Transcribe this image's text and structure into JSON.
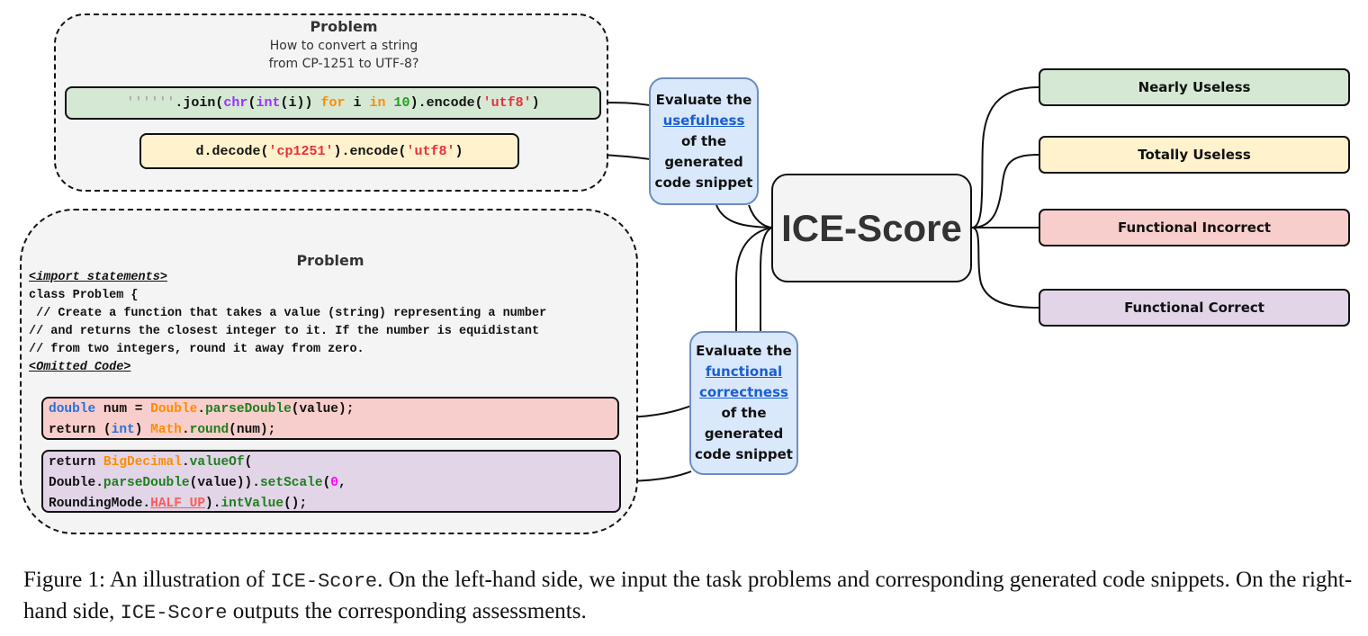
{
  "colors": {
    "green_box": "#d5e8d4",
    "yellow_box": "#fff2cc",
    "red_box": "#f8cecc",
    "purple_box": "#e1d5e7",
    "bubble": "#dae8fc",
    "bubble_border": "#6c8ebf",
    "center_box": "#f4f4f4"
  },
  "top_group": {
    "title": "Problem",
    "description_line1": "How to convert a string",
    "description_line2": "from CP-1251 to UTF-8?",
    "snippet_1": {
      "tokens": [
        "''''''",
        ".join(",
        "chr",
        "(",
        "int",
        "(i)) ",
        "for",
        " i ",
        "in",
        " ",
        "10",
        ").encode(",
        "'utf8'",
        ")"
      ]
    },
    "snippet_2": {
      "tokens": [
        "d.decode(",
        "'cp1251'",
        ").encode(",
        "'utf8'",
        ")"
      ]
    }
  },
  "bottom_group": {
    "title": "Problem",
    "import_tag": "<import statements>",
    "class_line": "class Problem {",
    "comment_1": " // Create a function that takes a value (string) representing a number",
    "comment_2": "// and returns the closest integer to it. If the number is equidistant",
    "comment_3": "// from two integers, round it away from zero.",
    "omitted_tag": "<Omitted Code>",
    "snippet_1": {
      "line1": [
        "double",
        " num = ",
        "Double",
        ".",
        "parseDouble",
        "(value);"
      ],
      "line2": [
        "return (",
        "int",
        ") ",
        "Math",
        ".",
        "round",
        "(num);"
      ]
    },
    "snippet_2": {
      "line1": [
        "return ",
        "BigDecimal",
        ".",
        "valueOf",
        "("
      ],
      "line2": [
        "Double.",
        "parseDouble",
        "(value)).",
        "setScale",
        "(",
        "0",
        ","
      ],
      "line3": [
        "RoundingMode.",
        "HALF_UP",
        ").",
        "intValue",
        "();"
      ]
    }
  },
  "bubble_usefulness": {
    "line1": "Evaluate the",
    "link": "usefulness",
    "line3": "of the",
    "line4": "generated",
    "line5": "code snippet"
  },
  "bubble_functional": {
    "line1": "Evaluate the",
    "link1": "functional",
    "link2": "correctness",
    "line4": "of the",
    "line5": "generated",
    "line6": "code snippet"
  },
  "center": {
    "label": "ICE-Score"
  },
  "outputs": [
    {
      "label": "Nearly Useless"
    },
    {
      "label": "Totally Useless"
    },
    {
      "label": "Functional Incorrect"
    },
    {
      "label": "Functional Correct"
    }
  ],
  "caption": {
    "prefix": "Figure 1: An illustration of ",
    "mono1": "ICE-Score",
    "middle": ". On the left-hand side, we input the task problems and corresponding generated code snippets. On the right-hand side, ",
    "mono2": "ICE-Score",
    "suffix": " outputs the corresponding assessments."
  }
}
